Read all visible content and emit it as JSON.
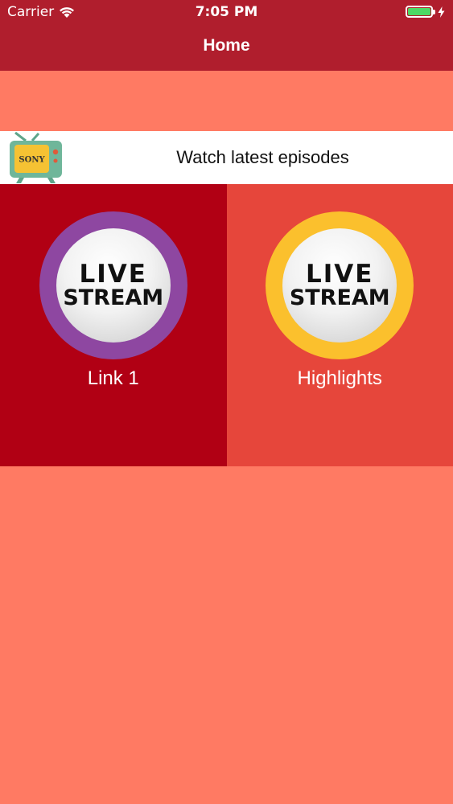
{
  "status_bar": {
    "carrier": "Carrier",
    "time": "7:05 PM",
    "battery_level": 1.0,
    "battery_color": "#4cd964"
  },
  "nav": {
    "title": "Home",
    "background": "#b01e2d"
  },
  "banner": {
    "logo_text": "SONY",
    "text": "Watch latest episodes"
  },
  "tiles": [
    {
      "icon_line1": "LIVE",
      "icon_line2": "STREAM",
      "label": "Link 1",
      "background": "#b10014",
      "ring_color": "#8e47a1"
    },
    {
      "icon_line1": "LIVE",
      "icon_line2": "STREAM",
      "label": "Highlights",
      "background": "#e6463b",
      "ring_color": "#fbc02d"
    }
  ],
  "page_background": "#ff7a63"
}
